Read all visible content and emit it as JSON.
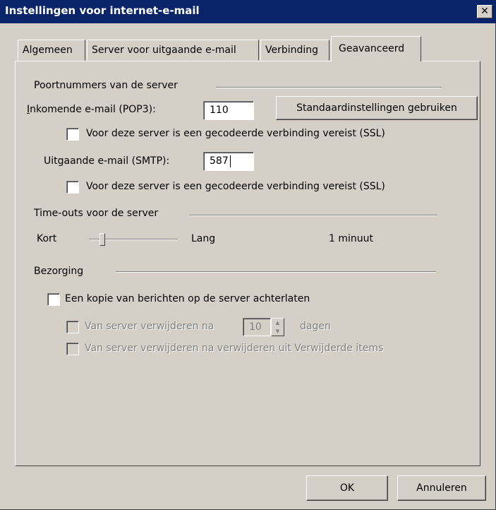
{
  "window": {
    "title": "Instellingen voor internet-e-mail",
    "close_glyph": "✕"
  },
  "tabs": [
    {
      "label": "Algemeen",
      "active": false
    },
    {
      "label": "Server voor uitgaande e-mail",
      "active": false
    },
    {
      "label": "Verbinding",
      "active": false
    },
    {
      "label": "Geavanceerd",
      "active": true
    }
  ],
  "ports": {
    "section_title": "Poortnummers van de server",
    "incoming_label": "Inkomende e-mail (POP3):",
    "incoming_value": "110",
    "defaults_button": "Standaardinstellingen gebruiken",
    "incoming_ssl_label": "Voor deze server is een gecodeerde verbinding vereist (SSL)",
    "incoming_ssl_checked": false,
    "outgoing_label": "Uitgaande e-mail (SMTP):",
    "outgoing_value": "587",
    "outgoing_ssl_label": "Voor deze server is een gecodeerde verbinding vereist (SSL)",
    "outgoing_ssl_checked": false
  },
  "timeouts": {
    "section_title": "Time-outs voor de server",
    "short_label": "Kort",
    "long_label": "Lang",
    "value_text": "1 minuut",
    "slider_fraction": 0.15
  },
  "delivery": {
    "section_title": "Bezorging",
    "leave_copy_label": "Een kopie van berichten op de server achterlaten",
    "leave_copy_checked": false,
    "remove_after_label": "Van server verwijderen na",
    "remove_after_value": "10",
    "remove_after_unit": "dagen",
    "remove_deleted_label": "Van server verwijderen na verwijderen uit Verwijderde items"
  },
  "footer": {
    "ok_label": "OK",
    "cancel_label": "Annuleren"
  }
}
